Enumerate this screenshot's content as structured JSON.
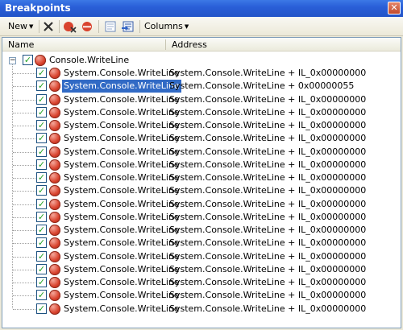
{
  "window": {
    "title": "Breakpoints",
    "close_label": "✕"
  },
  "toolbar": {
    "new_label": "New",
    "columns_label": "Columns",
    "icons": [
      "delete-icon",
      "disable-all-icon",
      "delete-all-icon",
      "goto-source-icon",
      "goto-disassembly-icon"
    ]
  },
  "columns": {
    "name": "Name",
    "address": "Address"
  },
  "colors": {
    "selection": "#316ac5",
    "breakpoint": "#d9432e",
    "checkmark": "#21a121"
  },
  "tree": {
    "root": {
      "label": "Console.WriteLine",
      "expanded": true,
      "checked": true
    },
    "children": [
      {
        "name": "System.Console.WriteLine",
        "address": "System.Console.WriteLine + IL_0x00000000",
        "checked": true,
        "selected": false
      },
      {
        "name": "System.Console.WriteLine",
        "address": "System.Console.WriteLine + 0x00000055",
        "checked": true,
        "selected": true
      },
      {
        "name": "System.Console.WriteLine",
        "address": "System.Console.WriteLine + IL_0x00000000",
        "checked": true,
        "selected": false
      },
      {
        "name": "System.Console.WriteLine",
        "address": "System.Console.WriteLine + IL_0x00000000",
        "checked": true,
        "selected": false
      },
      {
        "name": "System.Console.WriteLine",
        "address": "System.Console.WriteLine + IL_0x00000000",
        "checked": true,
        "selected": false
      },
      {
        "name": "System.Console.WriteLine",
        "address": "System.Console.WriteLine + IL_0x00000000",
        "checked": true,
        "selected": false
      },
      {
        "name": "System.Console.WriteLine",
        "address": "System.Console.WriteLine + IL_0x00000000",
        "checked": true,
        "selected": false
      },
      {
        "name": "System.Console.WriteLine",
        "address": "System.Console.WriteLine + IL_0x00000000",
        "checked": true,
        "selected": false
      },
      {
        "name": "System.Console.WriteLine",
        "address": "System.Console.WriteLine + IL_0x00000000",
        "checked": true,
        "selected": false
      },
      {
        "name": "System.Console.WriteLine",
        "address": "System.Console.WriteLine + IL_0x00000000",
        "checked": true,
        "selected": false
      },
      {
        "name": "System.Console.WriteLine",
        "address": "System.Console.WriteLine + IL_0x00000000",
        "checked": true,
        "selected": false
      },
      {
        "name": "System.Console.WriteLine",
        "address": "System.Console.WriteLine + IL_0x00000000",
        "checked": true,
        "selected": false
      },
      {
        "name": "System.Console.WriteLine",
        "address": "System.Console.WriteLine + IL_0x00000000",
        "checked": true,
        "selected": false
      },
      {
        "name": "System.Console.WriteLine",
        "address": "System.Console.WriteLine + IL_0x00000000",
        "checked": true,
        "selected": false
      },
      {
        "name": "System.Console.WriteLine",
        "address": "System.Console.WriteLine + IL_0x00000000",
        "checked": true,
        "selected": false
      },
      {
        "name": "System.Console.WriteLine",
        "address": "System.Console.WriteLine + IL_0x00000000",
        "checked": true,
        "selected": false
      },
      {
        "name": "System.Console.WriteLine",
        "address": "System.Console.WriteLine + IL_0x00000000",
        "checked": true,
        "selected": false
      },
      {
        "name": "System.Console.WriteLine",
        "address": "System.Console.WriteLine + IL_0x00000000",
        "checked": true,
        "selected": false
      },
      {
        "name": "System.Console.WriteLine",
        "address": "System.Console.WriteLine + IL_0x00000000",
        "checked": true,
        "selected": false
      }
    ]
  }
}
